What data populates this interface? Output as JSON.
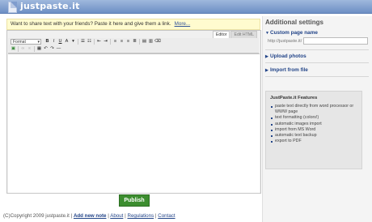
{
  "header": {
    "logo_main": "justpaste",
    "logo_dot": ".",
    "logo_end": "it"
  },
  "notice": {
    "text": "Want to share text with your friends? Paste it here and give them a link.",
    "more": "More..."
  },
  "editor": {
    "tabs": {
      "editor": "Editor",
      "edit_html": "Edit HTML"
    },
    "format_select": "Format",
    "toolbar": {
      "bold": "B",
      "italic": "I",
      "underline": "U",
      "font_color": "A"
    }
  },
  "publish_label": "Publish",
  "footer": {
    "copyright": "(C)Copyright 2009 justpaste.it",
    "links": [
      "Add new note",
      "About",
      "Regulations",
      "Contact"
    ],
    "sep": "|"
  },
  "sidebar": {
    "title": "Additional settings",
    "custom_name": {
      "label": "Custom page name",
      "url_prefix": "http://justpaste.it/"
    },
    "upload": "Upload photos",
    "import": "Import from file",
    "features": {
      "title": "JustPaste.it Features",
      "items": [
        "paste text directly from word processor or WWW page",
        "text formatting (colors!)",
        "automatic images import",
        "import from MS Word",
        "automatic text backup",
        "export to PDF"
      ]
    }
  }
}
